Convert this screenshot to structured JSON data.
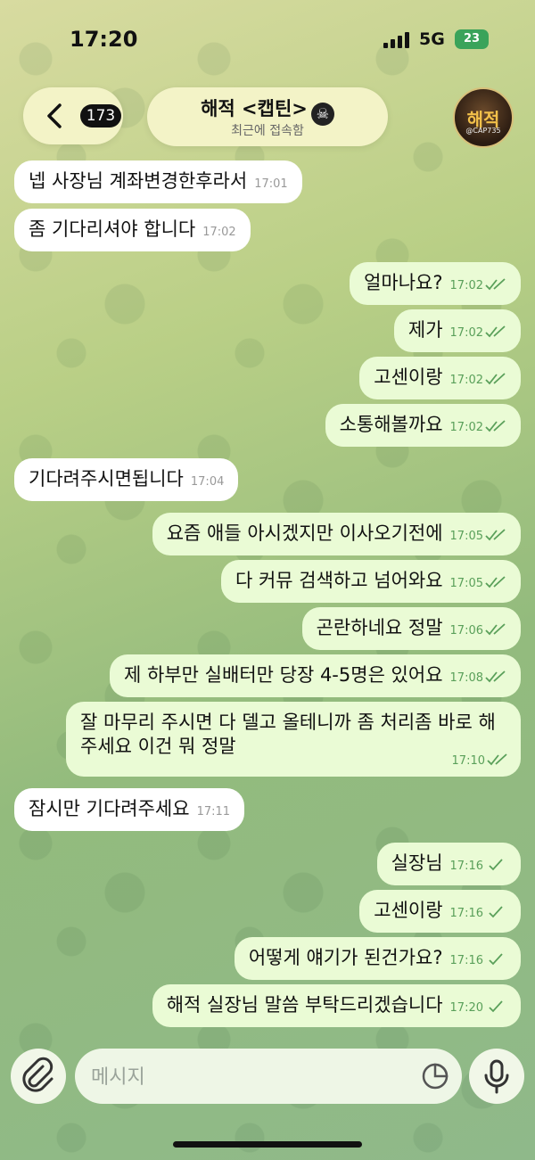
{
  "status_bar": {
    "time": "17:20",
    "network": "5G",
    "battery": "23"
  },
  "header": {
    "back_count": "173",
    "title": "해적 <캡틴>",
    "title_emoji": "☠",
    "subtitle": "최근에 접속함",
    "avatar_text": "해적",
    "avatar_tag": "@CAP735"
  },
  "messages": [
    {
      "dir": "in",
      "text": "넵 사장님 계좌변경한후라서",
      "time": "17:01"
    },
    {
      "dir": "in",
      "text": "좀 기다리셔야 합니다",
      "time": "17:02"
    },
    {
      "dir": "out",
      "text": "얼마나요?",
      "time": "17:02"
    },
    {
      "dir": "out",
      "text": "제가",
      "time": "17:02"
    },
    {
      "dir": "out",
      "text": "고센이랑",
      "time": "17:02"
    },
    {
      "dir": "out",
      "text": "소통해볼까요",
      "time": "17:02"
    },
    {
      "dir": "in",
      "text": "기다려주시면됩니다",
      "time": "17:04"
    },
    {
      "dir": "out",
      "text": "요즘 애들 아시겠지만 이사오기전에",
      "time": "17:05"
    },
    {
      "dir": "out",
      "text": "다 커뮤 검색하고 넘어와요",
      "time": "17:05"
    },
    {
      "dir": "out",
      "text": "곤란하네요 정말",
      "time": "17:06"
    },
    {
      "dir": "out",
      "text": "제 하부만 실배터만 당장 4-5명은 있어요",
      "time": "17:08"
    },
    {
      "dir": "out",
      "text": "잘 마무리 주시면 다 델고 올테니까 좀 처리좀 바로 해주세요 이건 뭐 정말",
      "time": "17:10"
    },
    {
      "dir": "in",
      "text": "잠시만 기다려주세요",
      "time": "17:11"
    },
    {
      "dir": "out",
      "text": "실장님",
      "time": "17:16"
    },
    {
      "dir": "out",
      "text": "고센이랑",
      "time": "17:16"
    },
    {
      "dir": "out",
      "text": "어떻게 얘기가 된건가요?",
      "time": "17:16"
    },
    {
      "dir": "out",
      "text": "해적 실장님 말씀 부탁드리겠습니다",
      "time": "17:20"
    }
  ],
  "input": {
    "placeholder": "메시지"
  },
  "colors": {
    "incoming_bubble": "#ffffff",
    "outgoing_bubble": "#eafbd5",
    "read_ticks": "#5aa05a"
  }
}
